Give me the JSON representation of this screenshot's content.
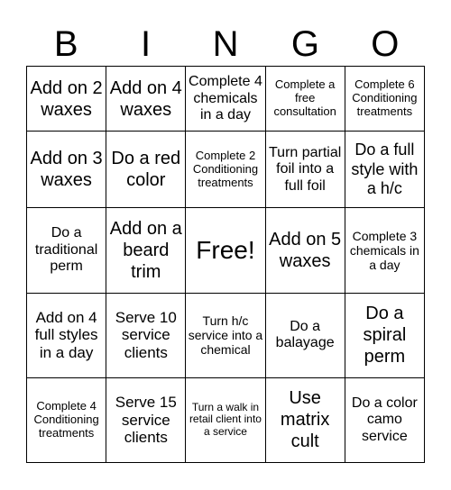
{
  "header": {
    "letters": [
      "B",
      "I",
      "N",
      "G",
      "O"
    ]
  },
  "board": {
    "rows": [
      [
        "Add on 2 waxes",
        "Add on 4 waxes",
        "Complete 4 chemicals in a day",
        "Complete a free consultation",
        "Complete 6 Conditioning treatments"
      ],
      [
        "Add on 3 waxes",
        "Do a red color",
        "Complete 2 Conditioning treatments",
        "Turn partial foil into a full foil",
        "Do a full style with a h/c"
      ],
      [
        "Do a traditional perm",
        "Add on a beard trim",
        "Free!",
        "Add on 5 waxes",
        "Complete 3 chemicals in a day"
      ],
      [
        "Add on 4 full styles in a day",
        "Serve 10 service clients",
        "Turn h/c service into a chemical",
        "Do a balayage",
        "Do a spiral perm"
      ],
      [
        "Complete 4 Conditioning treatments",
        "Serve 15 service clients",
        "Turn a walk in retail client into a service",
        "Use matrix cult",
        "Do a color camo service"
      ]
    ],
    "free_space": {
      "row": 2,
      "col": 2
    }
  }
}
